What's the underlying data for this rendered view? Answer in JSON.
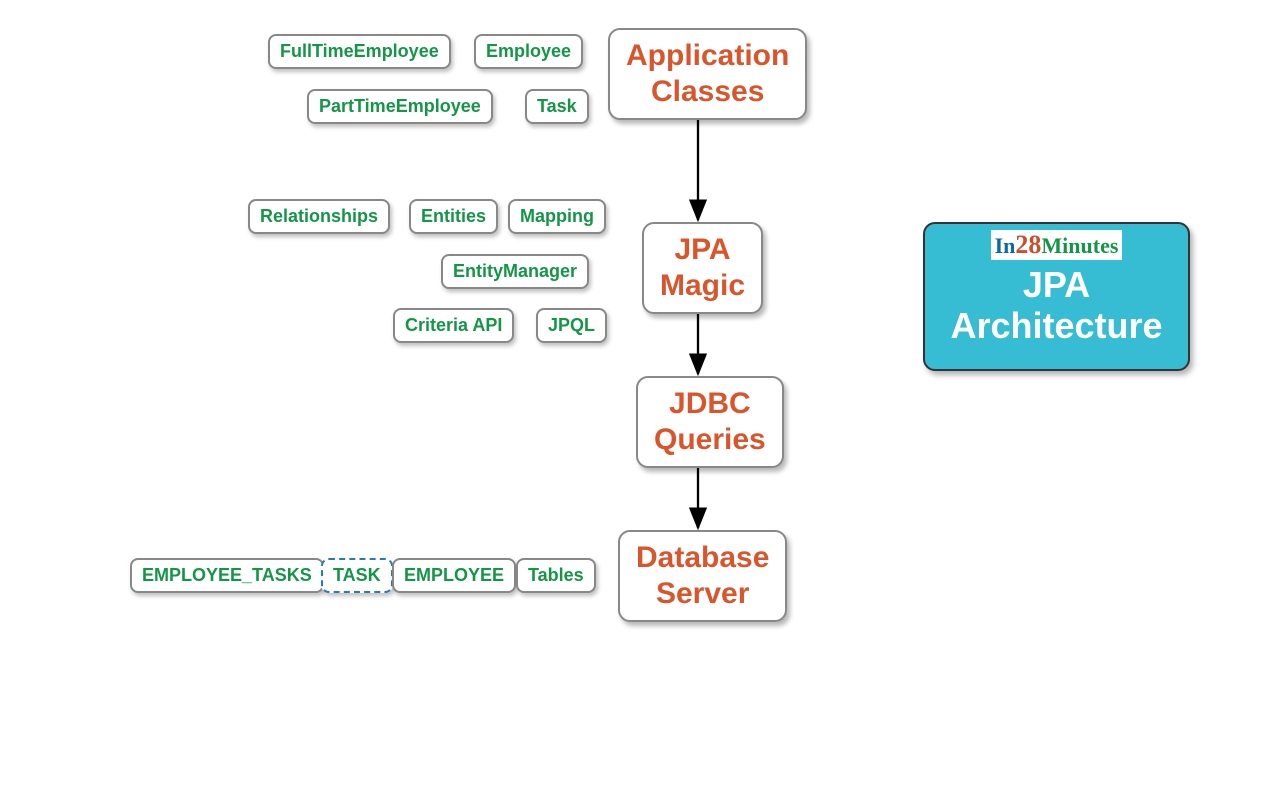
{
  "title_box": {
    "brand_in": "In",
    "brand_num": "28",
    "brand_minutes": "Minutes",
    "line1": "JPA",
    "line2": "Architecture"
  },
  "nodes": {
    "app_classes": {
      "line1": "Application",
      "line2": "Classes"
    },
    "jpa_magic": {
      "line1": "JPA",
      "line2": "Magic"
    },
    "jdbc_queries": {
      "line1": "JDBC",
      "line2": "Queries"
    },
    "database_server": {
      "line1": "Database",
      "line2": "Server"
    }
  },
  "children": {
    "full_time_employee": "FullTimeEmployee",
    "employee": "Employee",
    "part_time_employee": "PartTimeEmployee",
    "task": "Task",
    "relationships": "Relationships",
    "entities": "Entities",
    "mapping": "Mapping",
    "entity_manager": "EntityManager",
    "criteria_api": "Criteria API",
    "jpql": "JPQL",
    "employee_tasks": "EMPLOYEE_TASKS",
    "task_table": "TASK",
    "employee_table": "EMPLOYEE",
    "tables": "Tables"
  }
}
